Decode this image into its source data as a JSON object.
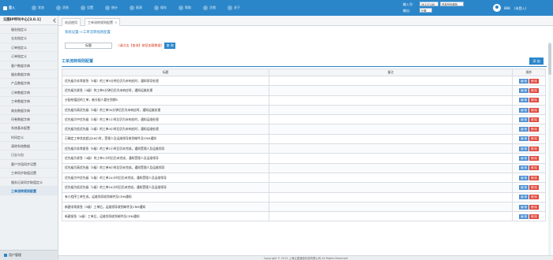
{
  "topbar": {
    "login": "登入",
    "nav": [
      "状态",
      "消息",
      "设置",
      "统计",
      "报表",
      "保存",
      "帮助",
      "注销",
      "关于"
    ],
    "input_label": "输入号:",
    "input_value": "26137186",
    "select_value": "选择号码模板",
    "output_label": "输出:",
    "output_value": "外置",
    "user": "888",
    "status": "(未登入)"
  },
  "sidebar": {
    "title": "云图IP呼叫中心[3.0.1]",
    "items": [
      "服务指定义",
      "业务指定义",
      "订单指定义",
      "订单指定义",
      "客户数据字典",
      "服务数据字典",
      "产品数据字典",
      "订单数据字典",
      "工单数据字典",
      "商务数据字典",
      "问卷数据字典",
      "系统基本配置",
      "时间定义",
      "清除系统数据",
      "日志与包",
      "客户字段同步设置",
      "工单同步取值设置",
      "服务记录同步取值定义",
      "工单流转规则配置"
    ],
    "active_index": 18,
    "bottom": "用户管理"
  },
  "tabs": [
    {
      "label": "欢迎使用"
    },
    {
      "label": "工单流转规则配置"
    }
  ],
  "breadcrumb": "系统设置->工单流转规则配置",
  "search": {
    "value": "标题",
    "hint": "(请点击【查询】按钮加载数据)",
    "button": "查 询"
  },
  "section": {
    "title": "工单流转规则配置",
    "add_button": "添 加"
  },
  "table": {
    "columns": [
      "标题",
      "备注",
      "操作"
    ],
    "edit_label": "编 辑",
    "delete_label": "删 除",
    "rows": [
      "优先级为非常紧急（5级）的工单5分钟后仍为未响应时，通知领导处理",
      "优先级为紧急（4级）的工单5分钟后仍为未响应时，通知运维处理",
      "分配给值班的工单，被分配人要在到期5",
      "优先级为高优先级（3级）的工单30分钟后仍为未响应时，通知运维处理",
      "优先级为中优先级（2级）的工单1小时后仍为未响应时，通知运维处理",
      "优先级为低优先级（1级）的工单4小时后仍为未响应时，通知运维处理",
      "已确定工单状态超过48小时，受理人及运维领导收到邮件及CRM通知",
      "优先级为非常紧急（5级）的工单1小时后仍未完成，通知受理人及运维领导",
      "优先级为紧急（4级）的工单2小时后仍未完成，通知受理人及运维领导",
      "优先级为高优先级（3级）的工单6小时后仍未完成，通知受理人及运维领导",
      "优先级为中优先级（2级）的工单24小时后仍未完成，通知受理人及运维领导",
      "优先级为低优先级（1级）的工单24小时后仍未完成，通知受理人及运维领导",
      "有小程序工单生成，运维领导收到邮件及CRM通知",
      "新建非常紧急（5级）工单后，运维领导收到邮件及CRM通知",
      "新建紧急（4级）工单后，运维领导收到邮件及CRM通知"
    ]
  },
  "footer": "Copyright © 2015 上海云翼通信科技有限公司 All Rights Reserved"
}
